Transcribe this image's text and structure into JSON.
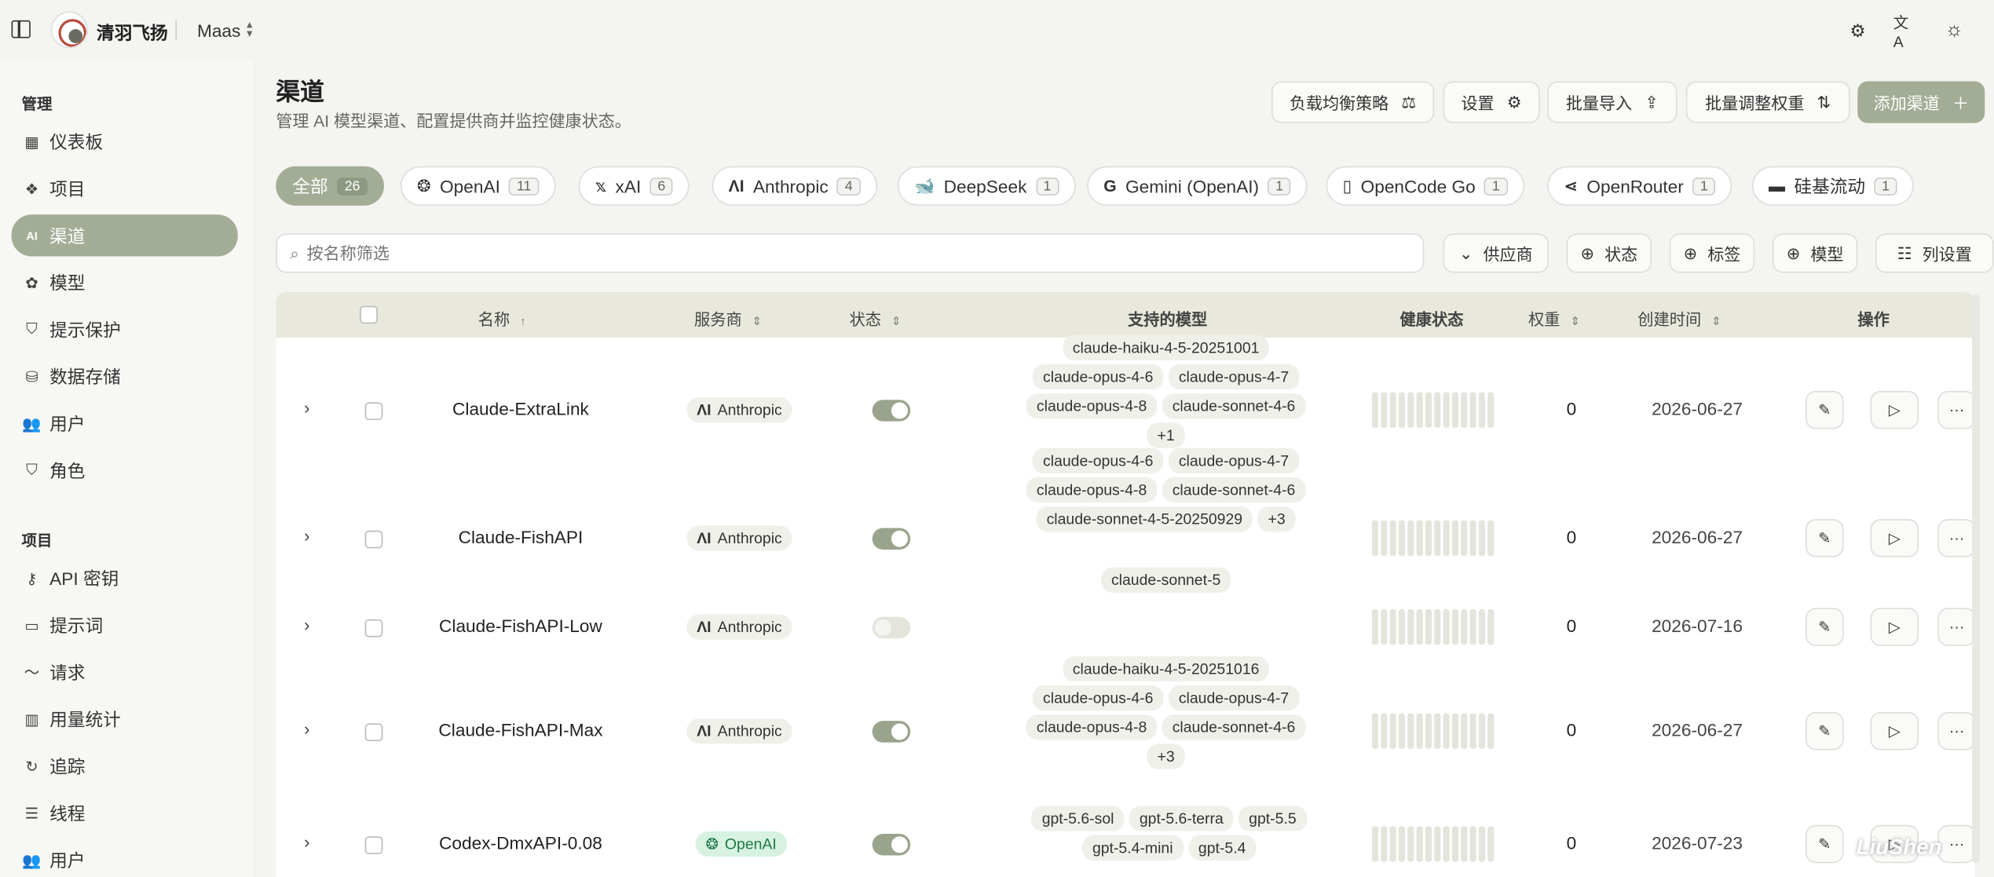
{
  "topbar": {
    "brand": "清羽飞扬",
    "project": "Maas",
    "icons": [
      "sidebar-toggle-icon",
      "gear-icon",
      "translate-icon",
      "sun-icon"
    ]
  },
  "sidebar": {
    "section1": "管理",
    "items1": [
      {
        "label": "仪表板",
        "icon": "dashboard-icon"
      },
      {
        "label": "项目",
        "icon": "projects-icon"
      },
      {
        "label": "渠道",
        "icon": "ai-icon"
      },
      {
        "label": "模型",
        "icon": "model-icon"
      },
      {
        "label": "提示保护",
        "icon": "shield-icon"
      },
      {
        "label": "数据存储",
        "icon": "database-icon"
      },
      {
        "label": "用户",
        "icon": "users-icon"
      },
      {
        "label": "角色",
        "icon": "shield-icon"
      }
    ],
    "section2": "项目",
    "items2": [
      {
        "label": "API 密钥",
        "icon": "key-icon"
      },
      {
        "label": "提示词",
        "icon": "note-icon"
      },
      {
        "label": "请求",
        "icon": "activity-icon"
      },
      {
        "label": "用量统计",
        "icon": "chart-icon"
      },
      {
        "label": "追踪",
        "icon": "trace-icon"
      },
      {
        "label": "线程",
        "icon": "list-icon"
      },
      {
        "label": "用户",
        "icon": "users-icon"
      }
    ]
  },
  "header": {
    "title": "渠道",
    "subtitle": "管理 AI 模型渠道、配置提供商并监控健康状态。",
    "buttons": {
      "lb": "负载均衡策略",
      "settings": "设置",
      "import": "批量导入",
      "weights": "批量调整权重",
      "add": "添加渠道"
    }
  },
  "filters": {
    "chips": [
      {
        "label": "全部",
        "count": "26"
      },
      {
        "label": "OpenAI",
        "count": "11"
      },
      {
        "label": "xAI",
        "count": "6"
      },
      {
        "label": "Anthropic",
        "count": "4"
      },
      {
        "label": "DeepSeek",
        "count": "1"
      },
      {
        "label": "Gemini (OpenAI)",
        "count": "1"
      },
      {
        "label": "OpenCode Go",
        "count": "1"
      },
      {
        "label": "OpenRouter",
        "count": "1"
      },
      {
        "label": "硅基流动",
        "count": "1"
      }
    ],
    "search_placeholder": "按名称筛选",
    "supplier": "供应商",
    "status": "状态",
    "tag": "标签",
    "model": "模型",
    "columns": "列设置"
  },
  "table": {
    "headers": {
      "name": "名称",
      "provider": "服务商",
      "status": "状态",
      "models": "支持的模型",
      "health": "健康状态",
      "weight": "权重",
      "created": "创建时间",
      "actions": "操作"
    },
    "rows": [
      {
        "name": "Claude-ExtraLink",
        "provider": "Anthropic",
        "enabled": true,
        "models": [
          "claude-haiku-4-5-20251001",
          "claude-opus-4-6",
          "claude-opus-4-7",
          "claude-opus-4-8",
          "claude-sonnet-4-6",
          "+1"
        ],
        "weight": "0",
        "created": "2026-06-27"
      },
      {
        "name": "Claude-FishAPI",
        "provider": "Anthropic",
        "enabled": true,
        "models": [
          "claude-opus-4-6",
          "claude-opus-4-7",
          "claude-opus-4-8",
          "claude-sonnet-4-6",
          "claude-sonnet-4-5-20250929",
          "+3"
        ],
        "weight": "0",
        "created": "2026-06-27"
      },
      {
        "name": "Claude-FishAPI-Low",
        "provider": "Anthropic",
        "enabled": false,
        "models": [
          "claude-sonnet-5"
        ],
        "weight": "0",
        "created": "2026-07-16"
      },
      {
        "name": "Claude-FishAPI-Max",
        "provider": "Anthropic",
        "enabled": true,
        "models": [
          "claude-haiku-4-5-20251016",
          "claude-opus-4-6",
          "claude-opus-4-7",
          "claude-opus-4-8",
          "claude-sonnet-4-6",
          "+3"
        ],
        "weight": "0",
        "created": "2026-06-27"
      },
      {
        "name": "Codex-DmxAPI-0.08",
        "provider": "OpenAI",
        "enabled": true,
        "models": [
          "gpt-5.6-sol",
          "gpt-5.6-terra",
          "gpt-5.5",
          "gpt-5.4-mini",
          "gpt-5.4"
        ],
        "weight": "0",
        "created": "2026-07-23"
      }
    ]
  },
  "watermark": "LiuShen"
}
